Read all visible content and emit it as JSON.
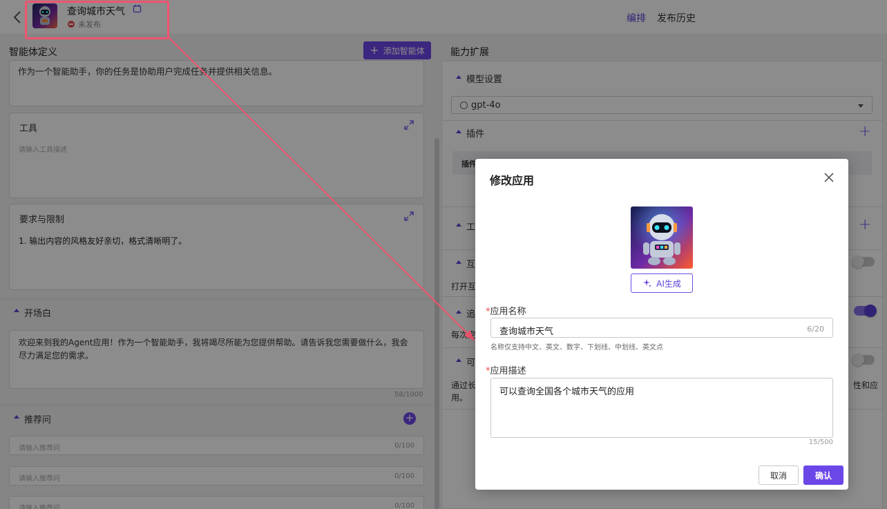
{
  "header": {
    "app_name": "查询城市天气",
    "status": "未发布",
    "tabs": [
      {
        "label": "编排",
        "active": true
      },
      {
        "label": "发布历史",
        "active": false
      }
    ]
  },
  "left": {
    "title": "智能体定义",
    "add_agent_label": "添加智能体",
    "definition_text": "作为一个智能助手，你的任务是协助用户完成任务并提供相关信息。",
    "tools": {
      "title": "工具",
      "placeholder": "请输入工具描述"
    },
    "limits": {
      "title": "要求与限制",
      "body": "1. 输出内容的风格友好亲切，格式清晰明了。"
    },
    "greeting": {
      "title": "开场白",
      "text": "欢迎来到我的Agent应用！作为一个智能助手，我将竭尽所能为您提供帮助。请告诉我您需要做什么，我会尽力满足您的需求。",
      "counter": "58/1000"
    },
    "recommend": {
      "title": "推荐问",
      "items": [
        {
          "placeholder": "请输入推荐问",
          "counter": "0/100"
        },
        {
          "placeholder": "请输入推荐问",
          "counter": "0/100"
        },
        {
          "placeholder": "请输入推荐问",
          "counter": "0/100"
        }
      ]
    }
  },
  "right": {
    "title": "能力扩展",
    "model_section": "模型设置",
    "model_value": "gpt-4o",
    "plugin_section": "插件",
    "plugin_row_label": "插件",
    "section3": "工",
    "section4": "互",
    "section4_text": "打开互",
    "section5": "追",
    "section5_text": "每次完",
    "section6": "可",
    "section6_text_1": "通过长",
    "section6_text_2": "用。",
    "section6_tail": "性和应"
  },
  "modal": {
    "title": "修改应用",
    "ai_button": "AI生成",
    "name_label": "应用名称",
    "name_value": "查询城市天气",
    "name_counter": "6/20",
    "name_hint": "名称仅支持中文、英文、数字、下划线、中划线、英文点",
    "desc_label": "应用描述",
    "desc_value": "可以查询全国各个城市天气的应用",
    "desc_counter": "15/500",
    "cancel": "取消",
    "confirm": "确认"
  },
  "colors": {
    "accent": "#6c47e8",
    "annotation": "#f0546e",
    "error": "#e5484d"
  }
}
